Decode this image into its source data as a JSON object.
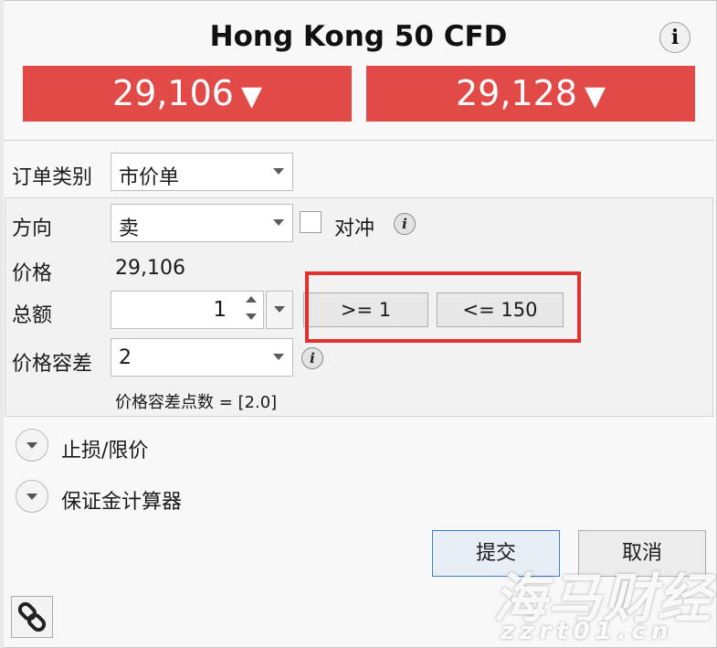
{
  "header": {
    "title": "Hong Kong 50 CFD",
    "info_label": "i"
  },
  "prices": {
    "sell": "29,106",
    "buy": "29,128",
    "arrow": "▼",
    "color": "#e24a48"
  },
  "order_type": {
    "label": "订单类别",
    "value": "市价单"
  },
  "direction": {
    "label": "方向",
    "value": "卖",
    "hedge_label": "对冲",
    "hedge_checked": false
  },
  "price": {
    "label": "价格",
    "value": "29,106"
  },
  "amount": {
    "label": "总额",
    "value": "1",
    "min_label": ">= 1",
    "max_label": "<= 150"
  },
  "tolerance": {
    "label": "价格容差",
    "value": "2",
    "points_text": "价格容差点数 = [2.0]"
  },
  "sections": {
    "stop_limit": "止损/限价",
    "margin_calc": "保证金计算器"
  },
  "actions": {
    "submit": "提交",
    "cancel": "取消"
  },
  "watermark": {
    "line1": "海马财经",
    "line2": "zzrt01.cn"
  },
  "colors": {
    "highlight": "#e2302f",
    "submit_border": "#3c7fd0"
  }
}
